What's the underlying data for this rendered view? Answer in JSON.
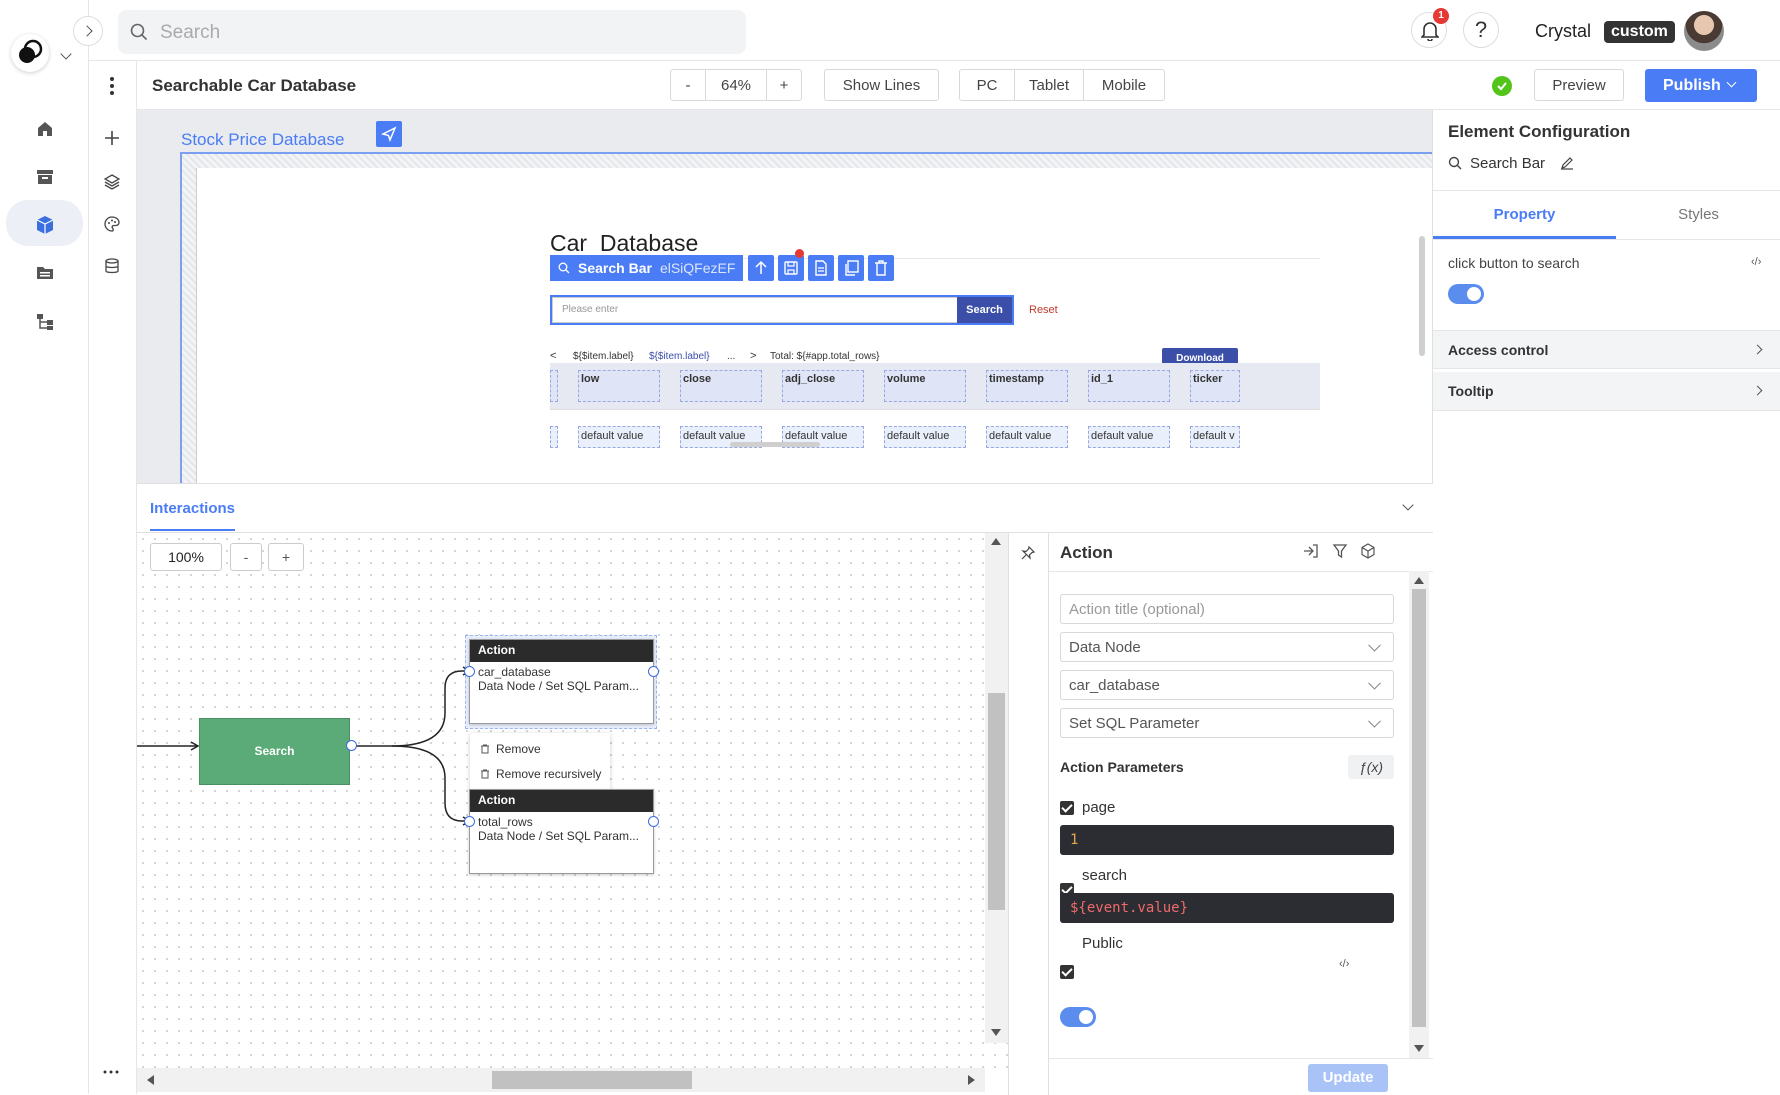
{
  "app": {
    "search_placeholder": "Search",
    "notif_count": "1",
    "user_name": "Crystal",
    "user_badge": "custom",
    "page_title": "Searchable Car Database"
  },
  "toolbar": {
    "zoom_minus": "-",
    "zoom": "64%",
    "zoom_plus": "+",
    "show_lines": "Show Lines",
    "devices": [
      "PC",
      "Tablet",
      "Mobile"
    ],
    "preview": "Preview",
    "publish": "Publish"
  },
  "canvas": {
    "frame_title": "Stock Price Database",
    "heading": "Car  Database",
    "selection_label": "Search Bar",
    "selection_id": "elSiQFezEF",
    "search_placeholder": "Please enter",
    "search_btn": "Search",
    "reset": "Reset",
    "pag_prev": "<",
    "pag_item1": "${$item.label}",
    "pag_item2": "${$item.label}",
    "pag_ellipsis": "...",
    "pag_next": ">",
    "total": "Total: ${#app.total_rows}",
    "download": "Download",
    "columns": [
      "low",
      "close",
      "adj_close",
      "volume",
      "timestamp",
      "id_1",
      "ticker"
    ],
    "cells": [
      "default value",
      "default value",
      "default value",
      "default value",
      "default value",
      "default value",
      "default v"
    ]
  },
  "config": {
    "title": "Element Configuration",
    "element": "Search Bar",
    "tabs": [
      "Property",
      "Styles"
    ],
    "active_tab": "Property",
    "toggle_label": "click button to search",
    "toggle_on": true,
    "sections": [
      "Access control",
      "Tooltip"
    ]
  },
  "interactions": {
    "tab": "Interactions",
    "zoom": "100%",
    "zoom_minus": "-",
    "zoom_plus": "+",
    "trigger_node": "Search",
    "action_nodes": [
      {
        "header": "Action",
        "target": "car_database",
        "desc": "Data Node / Set SQL Param..."
      },
      {
        "header": "Action",
        "target": "total_rows",
        "desc": "Data Node / Set SQL Param..."
      }
    ],
    "context_menu": [
      "Remove",
      "Remove recursively"
    ]
  },
  "action_panel": {
    "title": "Action",
    "title_placeholder": "Action title (optional)",
    "type": "Data Node",
    "target": "car_database",
    "method": "Set SQL Parameter",
    "params_label": "Action Parameters",
    "fx": "ƒ(x)",
    "params": [
      {
        "name": "page",
        "value": "1",
        "checked": true
      },
      {
        "name": "search",
        "value": "${event.value}",
        "checked": true
      }
    ],
    "public_label": "Public",
    "public_on": true,
    "update": "Update"
  },
  "colors": {
    "accent": "#4a7cf5",
    "node_green": "#5aab77",
    "search_btn": "#3b4fa8",
    "reset_red": "#c0392b",
    "status_green": "#52c41a"
  }
}
